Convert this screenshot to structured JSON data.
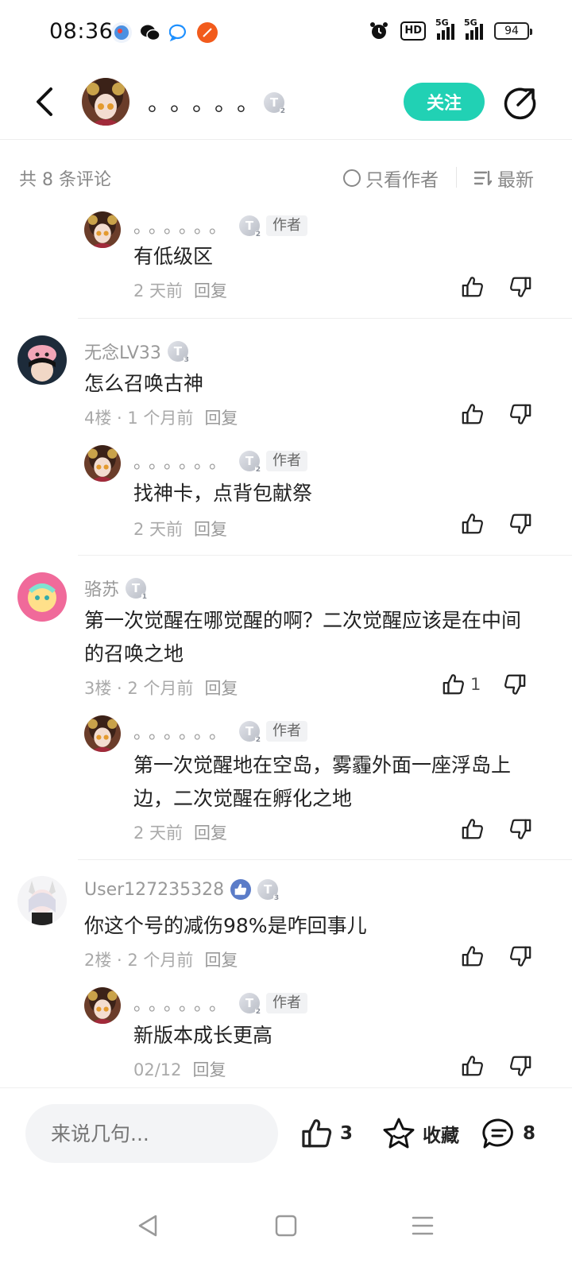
{
  "status_bar": {
    "time": "08:36",
    "battery": "94",
    "network": "5G",
    "hd_label": "HD"
  },
  "header": {
    "title": "。。。。。",
    "badge": "T",
    "badge_level": "2",
    "follow_label": "关注"
  },
  "comments_bar": {
    "count_text": "共 8 条评论",
    "only_author_label": "只看作者",
    "sort_label": "最新"
  },
  "author_tag": "作者",
  "comments": [
    {
      "reply_name": "。。。。。。",
      "reply_badge_level": "2",
      "reply_text": "有低级区",
      "reply_meta": "2 天前",
      "reply_action": "回复"
    },
    {
      "name": "无念LV33",
      "badge_level": "3",
      "text": "怎么召唤古神",
      "meta": "4楼 · 1 个月前",
      "reply_action": "回复",
      "reply": {
        "name": "。。。。。。",
        "badge_level": "2",
        "text": "找神卡，点背包献祭",
        "meta": "2 天前",
        "reply_action": "回复"
      }
    },
    {
      "name": "骆苏",
      "badge_level": "1",
      "text": "第一次觉醒在哪觉醒的啊？二次觉醒应该是在中间的召唤之地",
      "meta": "3楼 · 2 个月前",
      "reply_action": "回复",
      "likes": "1",
      "reply": {
        "name": "。。。。。。",
        "badge_level": "2",
        "text": "第一次觉醒地在空岛，雾霾外面一座浮岛上边，二次觉醒在孵化之地",
        "meta": "2 天前",
        "reply_action": "回复"
      }
    },
    {
      "name": "User127235328",
      "badge_level": "3",
      "text": "你这个号的减伤98%是咋回事儿",
      "meta": "2楼 · 2 个月前",
      "reply_action": "回复",
      "reply": {
        "name": "。。。。。。",
        "badge_level": "2",
        "text": "新版本成长更高",
        "meta": "02/12",
        "reply_action": "回复"
      }
    }
  ],
  "bottom_bar": {
    "input_placeholder": "来说几句...",
    "like_count": "3",
    "favorite_label": "收藏",
    "comment_count": "8"
  },
  "colors": {
    "accent": "#21d1b4",
    "text_primary": "#222222",
    "text_secondary": "#999999"
  }
}
